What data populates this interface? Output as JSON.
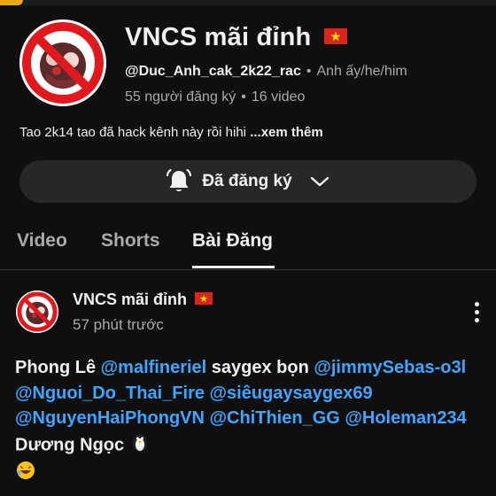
{
  "channel": {
    "name": "VNCS mãi đỉnh",
    "handle": "@Duc_Anh_cak_2k22_rac",
    "pronouns": "Anh ấy/he/him",
    "subscribers": "55 người đăng ký",
    "videos": "16 video",
    "description": "Tao 2k14 tao đã hack kênh này rồi hihi",
    "more_label": "...xem thêm",
    "flag_icon": "vietnam-flag-icon"
  },
  "subscribe": {
    "label": "Đã đăng ký",
    "bell_icon": "bell-icon",
    "chevron_icon": "chevron-down-icon"
  },
  "tabs": [
    {
      "label": "Video",
      "active": false
    },
    {
      "label": "Shorts",
      "active": false
    },
    {
      "label": "Bài Đăng",
      "active": true
    }
  ],
  "post": {
    "author": "VNCS mãi đỉnh",
    "time": "57 phút trước",
    "body": [
      {
        "text": "Phong Lê ",
        "type": "text"
      },
      {
        "text": "@malfineriel",
        "type": "mention"
      },
      {
        "text": " saygex bọn ",
        "type": "text"
      },
      {
        "text": "@jimmySebas-o3l",
        "type": "mention"
      },
      {
        "text": " ",
        "type": "text"
      },
      {
        "text": "@Nguoi_Do_Thai_Fire",
        "type": "mention"
      },
      {
        "text": " ",
        "type": "text"
      },
      {
        "text": "@siêugaysaygex69",
        "type": "mention"
      },
      {
        "text": " ",
        "type": "text"
      },
      {
        "text": "@NguyenHaiPhongVN",
        "type": "mention"
      },
      {
        "text": " ",
        "type": "text"
      },
      {
        "text": "@ChiThien_GG",
        "type": "mention"
      },
      {
        "text": " ",
        "type": "text"
      },
      {
        "text": "@Holeman234",
        "type": "mention"
      },
      {
        "text": " Dương Ngọc ",
        "type": "text"
      }
    ],
    "emojis": [
      "penguin-emoji",
      "rolling-laughing-emoji"
    ]
  },
  "colors": {
    "background": "#0f0f0f",
    "mention": "#3ea6ff",
    "secondary_text": "#aaaaaa",
    "button_bg": "#272727"
  }
}
